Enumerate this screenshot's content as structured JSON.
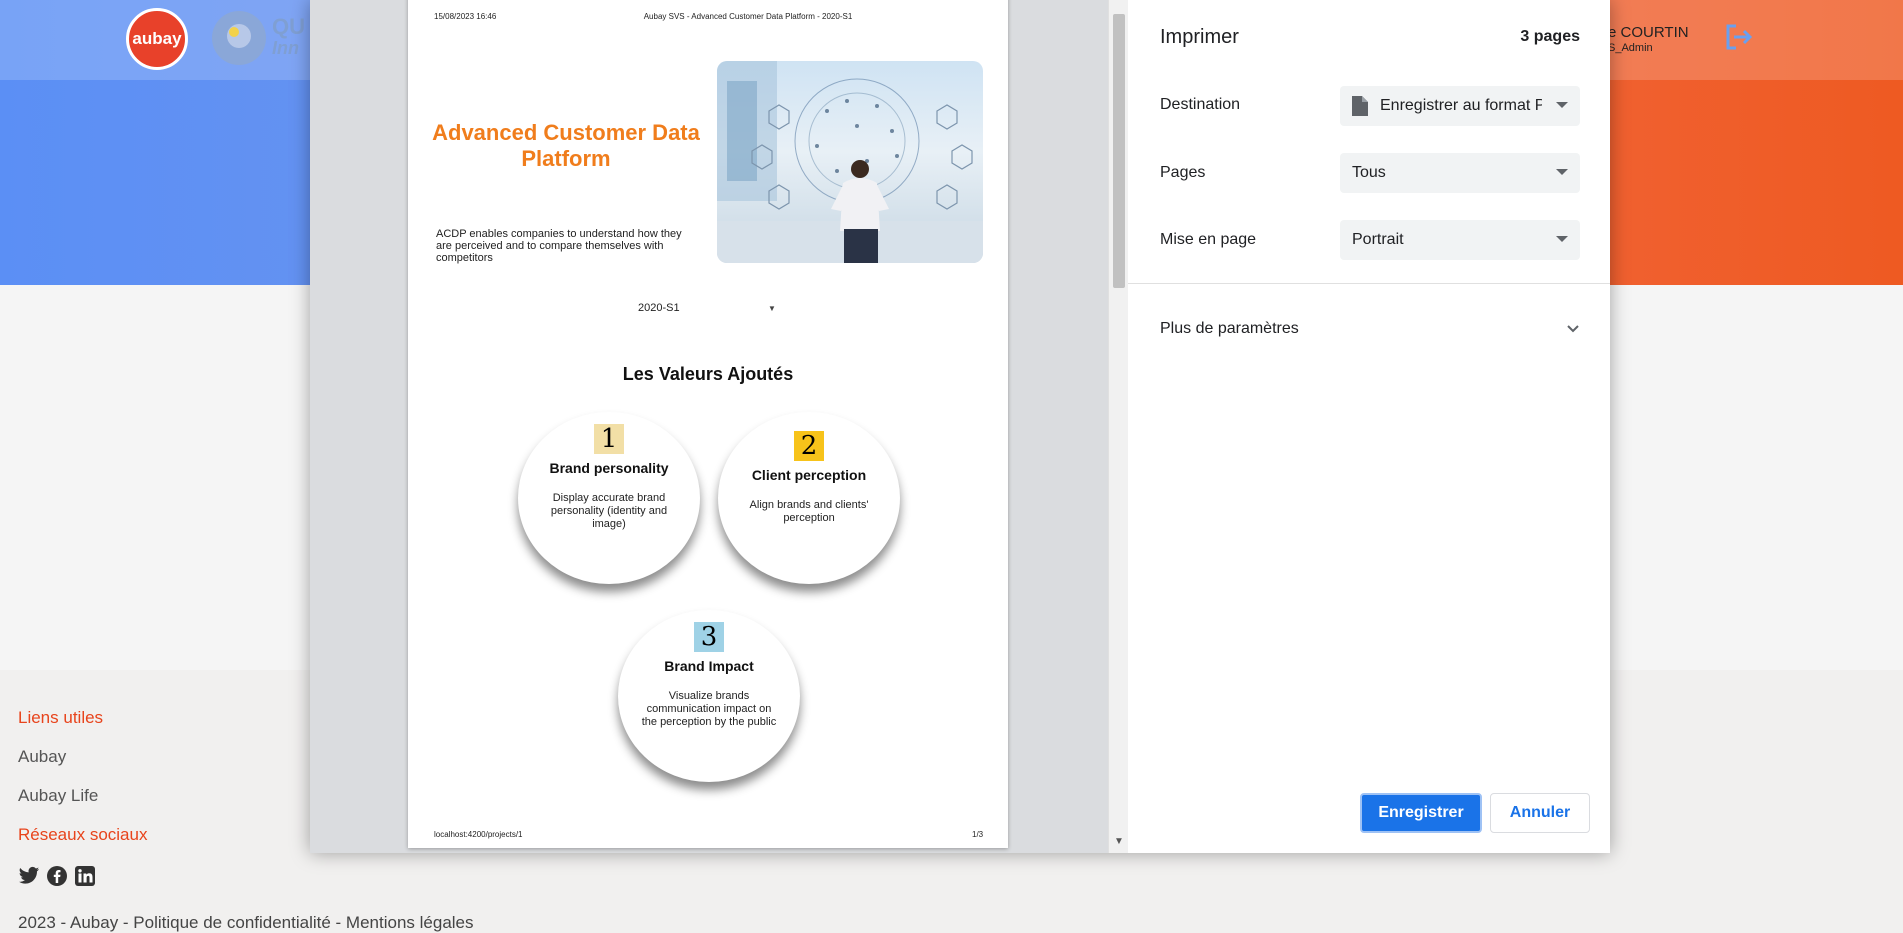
{
  "app": {
    "logo_text": "aubay",
    "innov_text": "QU",
    "innov_sub": "Inn",
    "user_name": "e COURTIN",
    "user_role": "S_Admin"
  },
  "footer": {
    "useful_links": "Liens utiles",
    "aubay": "Aubay",
    "aubay_life": "Aubay Life",
    "social": "Réseaux sociaux",
    "copyright": "2023 - Aubay - Politique de confidentialité - Mentions légales",
    "icons": [
      "twitter-icon",
      "facebook-icon",
      "linkedin-icon"
    ]
  },
  "preview": {
    "date": "15/08/2023 16:46",
    "header": "Aubay SVS - Advanced Customer Data Platform - 2020-S1",
    "title": "Advanced Customer Data Platform",
    "description": "ACDP enables companies to understand how they are perceived and to compare themselves with competitors",
    "period": "2020-S1",
    "section_title": "Les Valeurs Ajoutés",
    "values": [
      {
        "number": "1",
        "title": "Brand personality",
        "desc": "Display accurate brand personality (identity and image)",
        "color": "#f2dfa6"
      },
      {
        "number": "2",
        "title": "Client perception",
        "desc": "Align brands and clients' perception",
        "color": "#f7c31a"
      },
      {
        "number": "3",
        "title": "Brand Impact",
        "desc": "Visualize brands communication impact on the perception by the public",
        "color": "#9fd2e6"
      }
    ],
    "url": "localhost:4200/projects/1",
    "page_number": "1/3"
  },
  "print": {
    "title": "Imprimer",
    "pages_count": "3 pages",
    "destination_label": "Destination",
    "destination_value": "Enregistrer au format P",
    "pages_label": "Pages",
    "pages_value": "Tous",
    "layout_label": "Mise en page",
    "layout_value": "Portrait",
    "more_settings": "Plus de paramètres",
    "save_button": "Enregistrer",
    "cancel_button": "Annuler"
  },
  "colors": {
    "accent": "#1a73e8",
    "brand_orange": "#e8441c",
    "title_orange": "#f07d1c"
  }
}
